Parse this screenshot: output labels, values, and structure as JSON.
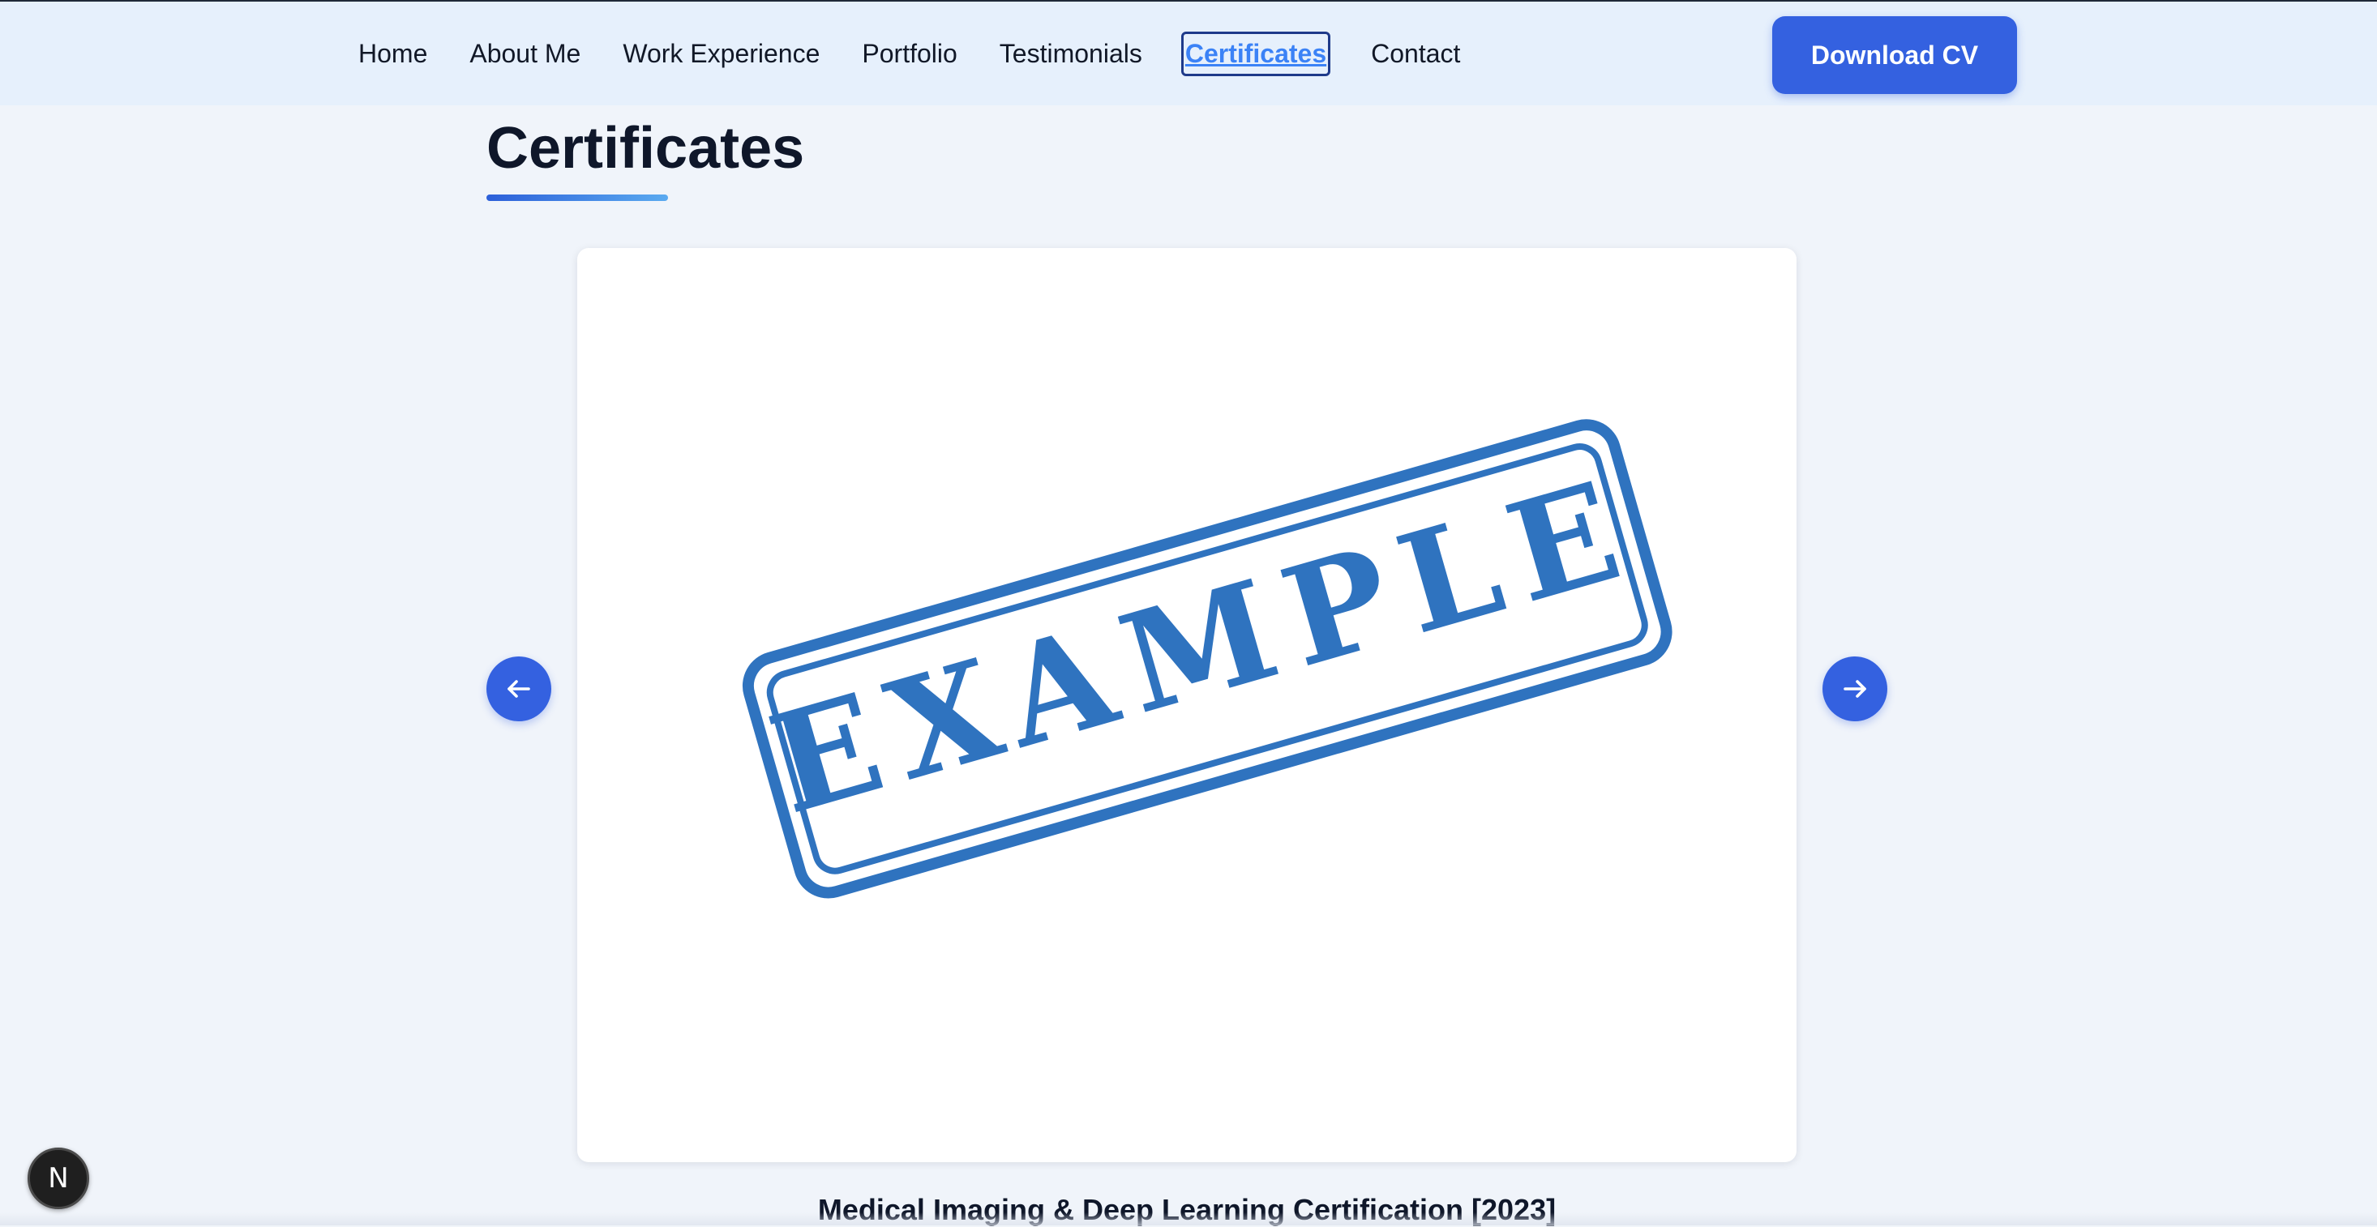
{
  "nav": {
    "links": [
      {
        "label": "Home"
      },
      {
        "label": "About Me"
      },
      {
        "label": "Work Experience"
      },
      {
        "label": "Portfolio"
      },
      {
        "label": "Testimonials"
      },
      {
        "label": "Certificates",
        "active": true
      },
      {
        "label": "Contact"
      }
    ],
    "download_label": "Download CV"
  },
  "section": {
    "title": "Certificates"
  },
  "carousel": {
    "prev_icon": "arrow-left-icon",
    "next_icon": "arrow-right-icon",
    "current": {
      "image_text": "EXAMPLE",
      "caption": "Medical Imaging & Deep Learning Certification [2023]"
    }
  },
  "dev_badge": {
    "letter": "N"
  },
  "colors": {
    "accent": "#3461e0",
    "stamp": "#2f73bf",
    "page_bg": "#f0f4fa",
    "nav_bg": "#e6f0fc"
  }
}
